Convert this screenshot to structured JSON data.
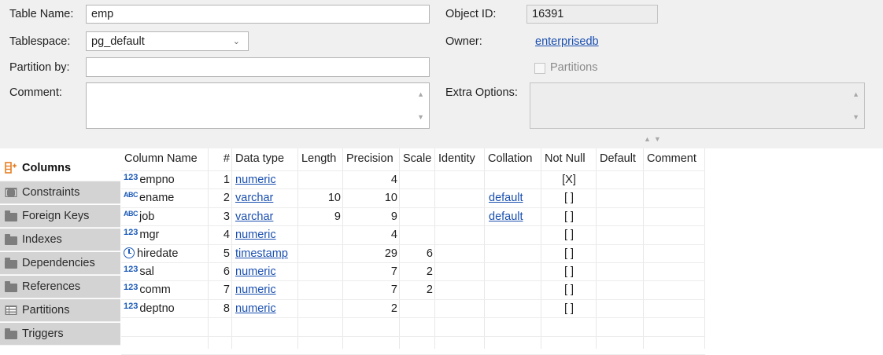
{
  "form": {
    "table_name_label": "Table Name:",
    "table_name_value": "emp",
    "tablespace_label": "Tablespace:",
    "tablespace_value": "pg_default",
    "partition_by_label": "Partition by:",
    "partition_by_value": "",
    "comment_label": "Comment:",
    "comment_value": "",
    "object_id_label": "Object ID:",
    "object_id_value": "16391",
    "owner_label": "Owner:",
    "owner_value": "enterprisedb",
    "partitions_checkbox_label": "Partitions",
    "partitions_checked": false,
    "extra_options_label": "Extra Options:",
    "extra_options_value": ""
  },
  "tabs": [
    {
      "label": "Columns",
      "icon": "columns-add-icon",
      "active": true
    },
    {
      "label": "Constraints",
      "icon": "constraints-icon"
    },
    {
      "label": "Foreign Keys",
      "icon": "folder-icon"
    },
    {
      "label": "Indexes",
      "icon": "folder-icon"
    },
    {
      "label": "Dependencies",
      "icon": "folder-icon"
    },
    {
      "label": "References",
      "icon": "folder-icon"
    },
    {
      "label": "Partitions",
      "icon": "partitions-icon"
    },
    {
      "label": "Triggers",
      "icon": "folder-icon"
    }
  ],
  "columns_table": {
    "headers": [
      "Column Name",
      "#",
      "Data type",
      "Length",
      "Precision",
      "Scale",
      "Identity",
      "Collation",
      "Not Null",
      "Default",
      "Comment"
    ],
    "rows": [
      {
        "type_icon": "123",
        "name": "empno",
        "num": "1",
        "data_type": "numeric",
        "length": "",
        "precision": "4",
        "scale": "",
        "identity": "",
        "collation": "",
        "not_null": "[X]",
        "default": "",
        "comment": ""
      },
      {
        "type_icon": "ABC",
        "name": "ename",
        "num": "2",
        "data_type": "varchar",
        "length": "10",
        "precision": "10",
        "scale": "",
        "identity": "",
        "collation": "default",
        "not_null": "[ ]",
        "default": "",
        "comment": ""
      },
      {
        "type_icon": "ABC",
        "name": "job",
        "num": "3",
        "data_type": "varchar",
        "length": "9",
        "precision": "9",
        "scale": "",
        "identity": "",
        "collation": "default",
        "not_null": "[ ]",
        "default": "",
        "comment": ""
      },
      {
        "type_icon": "123",
        "name": "mgr",
        "num": "4",
        "data_type": "numeric",
        "length": "",
        "precision": "4",
        "scale": "",
        "identity": "",
        "collation": "",
        "not_null": "[ ]",
        "default": "",
        "comment": ""
      },
      {
        "type_icon": "clock",
        "name": "hiredate",
        "num": "5",
        "data_type": "timestamp",
        "length": "",
        "precision": "29",
        "scale": "6",
        "identity": "",
        "collation": "",
        "not_null": "[ ]",
        "default": "",
        "comment": ""
      },
      {
        "type_icon": "123",
        "name": "sal",
        "num": "6",
        "data_type": "numeric",
        "length": "",
        "precision": "7",
        "scale": "2",
        "identity": "",
        "collation": "",
        "not_null": "[ ]",
        "default": "",
        "comment": ""
      },
      {
        "type_icon": "123",
        "name": "comm",
        "num": "7",
        "data_type": "numeric",
        "length": "",
        "precision": "7",
        "scale": "2",
        "identity": "",
        "collation": "",
        "not_null": "[ ]",
        "default": "",
        "comment": ""
      },
      {
        "type_icon": "123",
        "name": "deptno",
        "num": "8",
        "data_type": "numeric",
        "length": "",
        "precision": "2",
        "scale": "",
        "identity": "",
        "collation": "",
        "not_null": "[ ]",
        "default": "",
        "comment": ""
      }
    ]
  },
  "colors": {
    "link": "#1a4fb0",
    "type_icon": "#1c5ab8",
    "panel_bg": "#f0f0f0",
    "tab_bg": "#d3d3d3"
  }
}
